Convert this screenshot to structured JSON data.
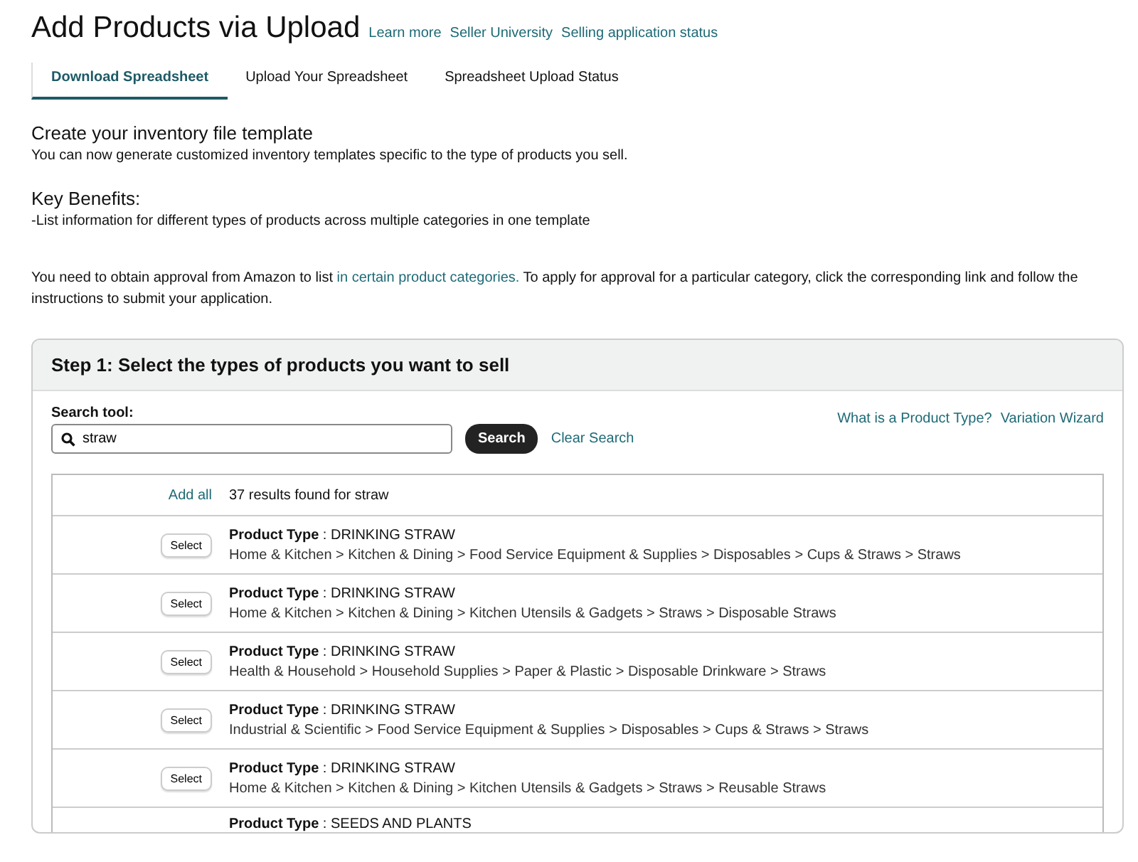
{
  "title": "Add Products via Upload",
  "header_links": [
    "Learn more",
    "Seller University",
    "Selling application status"
  ],
  "tabs": [
    {
      "label": "Download Spreadsheet",
      "selected": true
    },
    {
      "label": "Upload Your Spreadsheet",
      "selected": false
    },
    {
      "label": "Spreadsheet Upload Status",
      "selected": false
    }
  ],
  "template": {
    "heading": "Create your inventory file template",
    "text": "You can now generate customized inventory templates specific to the type of products you sell."
  },
  "benefits": {
    "heading": "Key Benefits:",
    "text": "-List information for different types of products across multiple categories in one template"
  },
  "approval": {
    "before": "You need to obtain approval from Amazon to list",
    "link": "in certain product categories.",
    "after": "To apply for approval for a particular category, click the corresponding link and follow the instructions to submit your application."
  },
  "step": {
    "title": "Step 1: Select the types of products you want to sell",
    "search_label": "Search tool:",
    "search_value": "straw",
    "search_button": "Search",
    "clear_link": "Clear Search",
    "help_links": [
      "What is a Product Type?",
      "Variation Wizard"
    ],
    "add_all": "Add all",
    "results_text": "37 results found for straw",
    "results": [
      {
        "text": "**Product Type** : DRINKING STRAW",
        "button": "Select",
        "path": "Home & Kitchen > Kitchen & Dining > Food Service Equipment & Supplies > Disposables > Cups & Straws > Straws"
      },
      {
        "text": "**Product Type** : DRINKING STRAW",
        "button": "Select",
        "path": "Home & Kitchen > Kitchen & Dining > Kitchen Utensils & Gadgets > Straws > Disposable Straws"
      },
      {
        "text": "**Product Type** : DRINKING STRAW",
        "button": "Select",
        "path": "Health & Household > Household Supplies > Paper & Plastic > Disposable Drinkware > Straws"
      },
      {
        "text": "**Product Type** : DRINKING STRAW",
        "button": "Select",
        "path": "Industrial & Scientific > Food Service Equipment & Supplies > Disposables > Cups & Straws > Straws"
      },
      {
        "text": "**Product Type** : DRINKING STRAW",
        "button": "Select",
        "path": "Home & Kitchen > Kitchen & Dining > Kitchen Utensils & Gadgets > Straws > Reusable Straws"
      },
      {
        "text": "**Product Type** : SEEDS AND PLANTS"
      }
    ]
  }
}
